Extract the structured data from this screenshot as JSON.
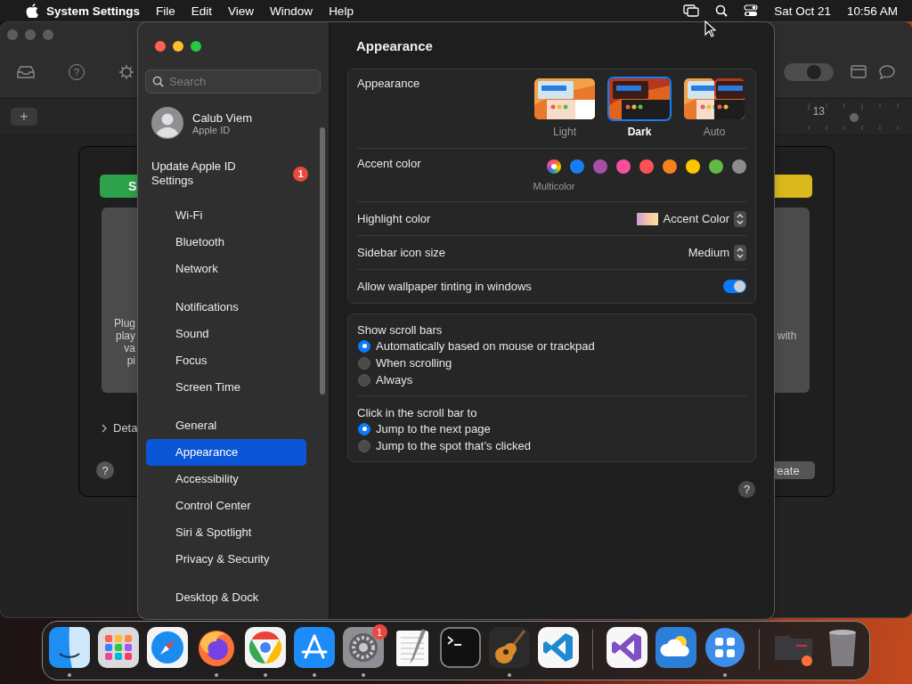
{
  "menu_bar": {
    "app_name": "System Settings",
    "menus": [
      "File",
      "Edit",
      "View",
      "Window",
      "Help"
    ],
    "date": "Sat Oct 21",
    "time": "10:56 AM"
  },
  "background_window": {
    "toolbar_help": "?",
    "toolbar_toggle_on": true,
    "add_label": "+",
    "ruler_label": "13",
    "sheet": {
      "left_button": "S",
      "left_text": [
        "Plug",
        "play",
        "va",
        "pi"
      ],
      "disclosure": "Deta",
      "help": "?",
      "right_text": "with",
      "right_button": "reate"
    }
  },
  "settings_window": {
    "title": "Appearance",
    "search": {
      "placeholder": "Search"
    },
    "account": {
      "name": "Calub Viem",
      "subtitle": "Apple ID"
    },
    "notice": {
      "label": "Update Apple ID Settings",
      "badge": "1"
    },
    "sidebar_groups": [
      [
        {
          "label": "Wi-Fi",
          "selected": false
        },
        {
          "label": "Bluetooth",
          "selected": false
        },
        {
          "label": "Network",
          "selected": false
        }
      ],
      [
        {
          "label": "Notifications",
          "selected": false
        },
        {
          "label": "Sound",
          "selected": false
        },
        {
          "label": "Focus",
          "selected": false
        },
        {
          "label": "Screen Time",
          "selected": false
        }
      ],
      [
        {
          "label": "General",
          "selected": false
        },
        {
          "label": "Appearance",
          "selected": true
        },
        {
          "label": "Accessibility",
          "selected": false
        },
        {
          "label": "Control Center",
          "selected": false
        },
        {
          "label": "Siri & Spotlight",
          "selected": false
        },
        {
          "label": "Privacy & Security",
          "selected": false
        }
      ],
      [
        {
          "label": "Desktop & Dock",
          "selected": false
        }
      ]
    ],
    "appearance": {
      "label": "Appearance",
      "options": [
        {
          "label": "Light",
          "kind": "light",
          "selected": false
        },
        {
          "label": "Dark",
          "kind": "dark",
          "selected": true
        },
        {
          "label": "Auto",
          "kind": "auto",
          "selected": false
        }
      ]
    },
    "accent": {
      "label": "Accent color",
      "selected_name": "Multicolor",
      "colors": [
        {
          "kind": "multicolor",
          "selected": true
        },
        {
          "kind": "solid",
          "color": "#1a7cf5",
          "selected": false
        },
        {
          "kind": "solid",
          "color": "#a550a7",
          "selected": false
        },
        {
          "kind": "solid",
          "color": "#f74f9e",
          "selected": false
        },
        {
          "kind": "solid",
          "color": "#ff5257",
          "selected": false
        },
        {
          "kind": "solid",
          "color": "#f7821b",
          "selected": false
        },
        {
          "kind": "solid",
          "color": "#ffc600",
          "selected": false
        },
        {
          "kind": "solid",
          "color": "#62ba46",
          "selected": false
        },
        {
          "kind": "solid",
          "color": "#8c8c8c",
          "selected": false
        }
      ]
    },
    "highlight": {
      "label": "Highlight color",
      "value": "Accent Color"
    },
    "icon_size": {
      "label": "Sidebar icon size",
      "value": "Medium"
    },
    "tinting": {
      "label": "Allow wallpaper tinting in windows",
      "on": true
    },
    "scroll_bars": {
      "label": "Show scroll bars",
      "options": [
        {
          "label": "Automatically based on mouse or trackpad",
          "selected": true
        },
        {
          "label": "When scrolling",
          "selected": false
        },
        {
          "label": "Always",
          "selected": false
        }
      ]
    },
    "click_scroll": {
      "label": "Click in the scroll bar to",
      "options": [
        {
          "label": "Jump to the next page",
          "selected": true
        },
        {
          "label": "Jump to the spot that’s clicked",
          "selected": false
        }
      ]
    },
    "help": "?"
  },
  "dock": [
    {
      "kind": "finder",
      "running": true
    },
    {
      "kind": "launchpad",
      "running": false
    },
    {
      "kind": "safari",
      "running": false
    },
    {
      "kind": "firefox",
      "running": true
    },
    {
      "kind": "chrome",
      "running": true
    },
    {
      "kind": "appstore",
      "running": true
    },
    {
      "kind": "settings",
      "running": true,
      "badge": "1"
    },
    {
      "kind": "textedit",
      "running": false
    },
    {
      "kind": "terminal",
      "running": false
    },
    {
      "kind": "guitar",
      "running": true
    },
    {
      "kind": "vscode",
      "running": false
    },
    {
      "kind": "separator"
    },
    {
      "kind": "visualstudio",
      "running": false
    },
    {
      "kind": "weather",
      "running": false
    },
    {
      "kind": "grid",
      "running": true
    },
    {
      "kind": "separator"
    },
    {
      "kind": "window",
      "running": false
    },
    {
      "kind": "trash",
      "running": false
    }
  ]
}
